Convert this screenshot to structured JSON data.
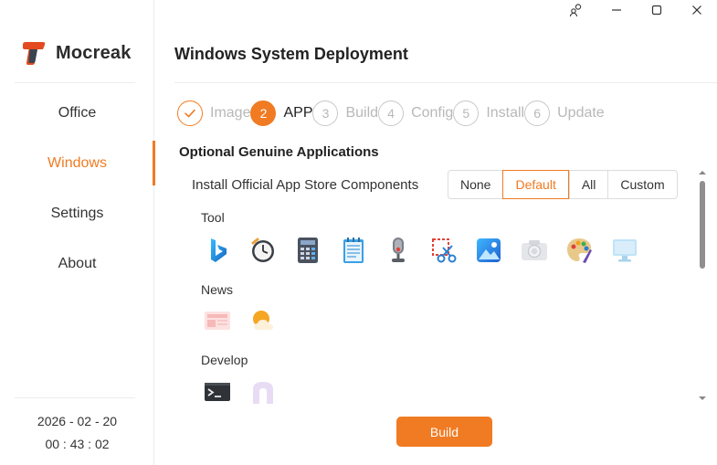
{
  "app": {
    "name": "Mocreak",
    "logo_icon": "mocreak-logo-icon"
  },
  "window_controls": [
    {
      "name": "account-icon"
    },
    {
      "name": "minimize-icon"
    },
    {
      "name": "maximize-icon"
    },
    {
      "name": "close-icon"
    }
  ],
  "sidebar": {
    "items": [
      {
        "label": "Office",
        "active": false
      },
      {
        "label": "Windows",
        "active": true
      },
      {
        "label": "Settings",
        "active": false
      },
      {
        "label": "About",
        "active": false
      }
    ],
    "date": "2026 - 02 - 20",
    "time": "00 : 43 : 02"
  },
  "main": {
    "title": "Windows System Deployment",
    "steps": [
      {
        "number": "✓",
        "label": "Image",
        "state": "done"
      },
      {
        "number": "2",
        "label": "APP",
        "state": "active"
      },
      {
        "number": "3",
        "label": "Build",
        "state": "pending"
      },
      {
        "number": "4",
        "label": "Config",
        "state": "pending"
      },
      {
        "number": "5",
        "label": "Install",
        "state": "pending"
      },
      {
        "number": "6",
        "label": "Update",
        "state": "pending"
      }
    ],
    "section_title": "Optional Genuine Applications",
    "install_label": "Install Official App Store Components",
    "options": [
      "None",
      "Default",
      "All",
      "Custom"
    ],
    "selected_option": "Default",
    "categories": [
      {
        "label": "Tool",
        "apps": [
          "bing-icon",
          "clock-icon",
          "calculator-icon",
          "notepad-icon",
          "voice-recorder-icon",
          "snipping-tool-icon",
          "photos-icon",
          "camera-icon",
          "paint-icon",
          "remote-desktop-icon"
        ]
      },
      {
        "label": "News",
        "apps": [
          "news-icon",
          "weather-icon"
        ]
      },
      {
        "label": "Develop",
        "apps": [
          "terminal-icon",
          "dev-home-icon"
        ]
      }
    ],
    "build_label": "Build"
  },
  "colors": {
    "accent": "#f07b22",
    "muted": "#b8b8b8"
  }
}
